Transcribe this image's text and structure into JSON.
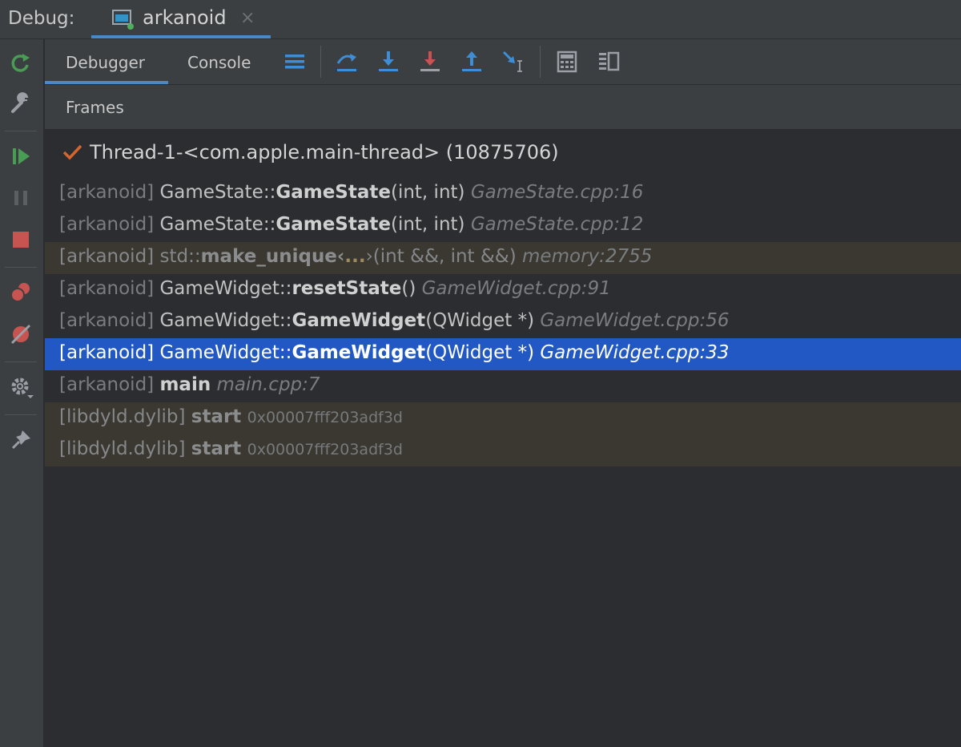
{
  "titlebar": {
    "debug_label": "Debug:",
    "tab_label": "arkanoid",
    "close": "×"
  },
  "toolbar": {
    "tabs": [
      {
        "label": "Debugger",
        "active": true
      },
      {
        "label": "Console",
        "active": false
      }
    ],
    "buttons": [
      "frames-list-icon",
      "step-over-icon",
      "step-into-icon",
      "force-step-into-icon",
      "step-out-icon",
      "run-to-cursor-icon",
      "evaluate-expression-icon",
      "layout-icon"
    ]
  },
  "frames_panel": {
    "header": "Frames",
    "thread": "Thread-1-<com.apple.main-thread> (10875706)",
    "frames": [
      {
        "module": "[arkanoid]",
        "ns": "GameState::",
        "fn": "GameState",
        "ell": "",
        "args": "(int, int)",
        "loc": "GameState.cpp:16",
        "addr": "",
        "kind": "normal"
      },
      {
        "module": "[arkanoid]",
        "ns": "GameState::",
        "fn": "GameState",
        "ell": "",
        "args": "(int, int)",
        "loc": "GameState.cpp:12",
        "addr": "",
        "kind": "normal"
      },
      {
        "module": "[arkanoid]",
        "ns": "std::",
        "fn": "make_unique‹",
        "ell": "...",
        "args": "›(int &&, int &&)",
        "loc": "memory:2755",
        "addr": "",
        "kind": "lib"
      },
      {
        "module": "[arkanoid]",
        "ns": "GameWidget::",
        "fn": "resetState",
        "ell": "",
        "args": "()",
        "loc": "GameWidget.cpp:91",
        "addr": "",
        "kind": "normal"
      },
      {
        "module": "[arkanoid]",
        "ns": "GameWidget::",
        "fn": "GameWidget",
        "ell": "",
        "args": "(QWidget *)",
        "loc": "GameWidget.cpp:56",
        "addr": "",
        "kind": "normal"
      },
      {
        "module": "[arkanoid]",
        "ns": "GameWidget::",
        "fn": "GameWidget",
        "ell": "",
        "args": "(QWidget *)",
        "loc": "GameWidget.cpp:33",
        "addr": "",
        "kind": "selected"
      },
      {
        "module": "[arkanoid]",
        "ns": "",
        "fn": "main",
        "ell": "",
        "args": "",
        "loc": "main.cpp:7",
        "addr": "",
        "kind": "normal"
      },
      {
        "module": "[libdyld.dylib]",
        "ns": "",
        "fn": "start",
        "ell": "",
        "args": "",
        "loc": "",
        "addr": "0x00007fff203adf3d",
        "kind": "lib"
      },
      {
        "module": "[libdyld.dylib]",
        "ns": "",
        "fn": "start",
        "ell": "",
        "args": "",
        "loc": "",
        "addr": "0x00007fff203adf3d",
        "kind": "lib"
      }
    ]
  },
  "colors": {
    "accent": "#4a88c7",
    "selection": "#2158c4",
    "library_row": "#3a3830",
    "resume_green": "#499c54",
    "stop_red": "#c75450",
    "check_orange": "#d4652e"
  }
}
